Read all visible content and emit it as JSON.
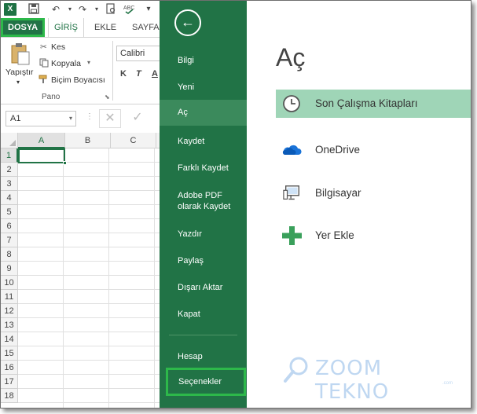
{
  "excel": {
    "app_icon": "excel-logo-icon",
    "tabs": {
      "file": "DOSYA",
      "home": "GİRİŞ",
      "insert": "EKLE",
      "page": "SAYFA"
    },
    "ribbon": {
      "paste": "Yapıştır",
      "cut": "Kes",
      "copy": "Kopyala",
      "format_painter": "Biçim Boyacısı",
      "group": "Pano",
      "font": "Calibri",
      "bold": "K",
      "italic": "T",
      "underline": "A"
    },
    "name_box": "A1",
    "columns": [
      "A",
      "B",
      "C"
    ],
    "rows": [
      "1",
      "2",
      "3",
      "4",
      "5",
      "6",
      "7",
      "8",
      "9",
      "10",
      "11",
      "12",
      "13",
      "14",
      "15",
      "16",
      "17",
      "18"
    ],
    "accent_color": "#217346"
  },
  "backstage": {
    "back_icon": "back-arrow-icon",
    "nav": [
      "Bilgi",
      "Yeni",
      "Aç",
      "Kaydet",
      "Farklı Kaydet",
      "Adobe PDF olarak Kaydet",
      "Yazdır",
      "Paylaş",
      "Dışarı Aktar",
      "Kapat",
      "Hesap",
      "Seçenekler"
    ],
    "active_nav": "Aç",
    "title": "Aç",
    "places": [
      {
        "label": "Son Çalışma Kitapları",
        "icon": "clock-icon"
      },
      {
        "label": "OneDrive",
        "icon": "cloud-icon"
      },
      {
        "label": "Bilgisayar",
        "icon": "computer-icon"
      },
      {
        "label": "Yer Ekle",
        "icon": "plus-icon"
      }
    ],
    "nav_color": "#217346",
    "highlight_color": "#9fd5b7"
  },
  "watermark": {
    "text": "ZOOM TEKNO",
    "sub": ".com"
  }
}
